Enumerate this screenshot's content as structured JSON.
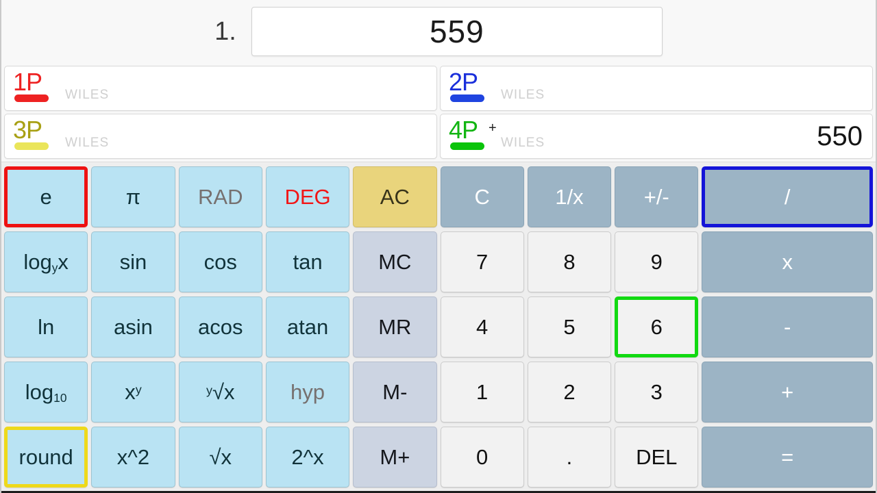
{
  "display": {
    "round_label": "1.",
    "value": "559"
  },
  "players": [
    {
      "id": "1P",
      "name": "WILES",
      "operator": "",
      "score": "",
      "color": "#ee2222",
      "bar_color": "#ee2222"
    },
    {
      "id": "2P",
      "name": "WILES",
      "operator": "",
      "score": "",
      "color": "#1a2fdb",
      "bar_color": "#1f44e0"
    },
    {
      "id": "3P",
      "name": "WILES",
      "operator": "",
      "score": "",
      "color": "#a8a014",
      "bar_color": "#eae55a"
    },
    {
      "id": "4P",
      "name": "WILES",
      "operator": "+",
      "score": "550",
      "color": "#12b512",
      "bar_color": "#0bc40b"
    }
  ],
  "keypad": {
    "rows": [
      [
        {
          "label": "e",
          "style": "k-fn",
          "highlight": "sel-red",
          "text_style": ""
        },
        {
          "label": "π",
          "style": "k-fn",
          "highlight": "",
          "text_style": ""
        },
        {
          "label": "RAD",
          "style": "k-fn",
          "highlight": "",
          "text_style": "t-gray"
        },
        {
          "label": "DEG",
          "style": "k-fn",
          "highlight": "",
          "text_style": "t-red"
        },
        {
          "label": "AC",
          "style": "k-ac",
          "highlight": "",
          "text_style": ""
        },
        {
          "label": "C",
          "style": "k-op",
          "highlight": "",
          "text_style": ""
        },
        {
          "label": "1/x",
          "style": "k-op",
          "highlight": "",
          "text_style": ""
        },
        {
          "label": "+/-",
          "style": "k-op",
          "highlight": "",
          "text_style": ""
        },
        {
          "label": "/",
          "style": "k-op",
          "highlight": "sel-blue",
          "text_style": ""
        }
      ],
      [
        {
          "label": "log_yx",
          "style": "k-fn",
          "highlight": "",
          "text_style": ""
        },
        {
          "label": "sin",
          "style": "k-fn",
          "highlight": "",
          "text_style": ""
        },
        {
          "label": "cos",
          "style": "k-fn",
          "highlight": "",
          "text_style": ""
        },
        {
          "label": "tan",
          "style": "k-fn",
          "highlight": "",
          "text_style": ""
        },
        {
          "label": "MC",
          "style": "k-mem",
          "highlight": "",
          "text_style": ""
        },
        {
          "label": "7",
          "style": "k-num",
          "highlight": "",
          "text_style": ""
        },
        {
          "label": "8",
          "style": "k-num",
          "highlight": "",
          "text_style": ""
        },
        {
          "label": "9",
          "style": "k-num",
          "highlight": "",
          "text_style": ""
        },
        {
          "label": "x",
          "style": "k-op",
          "highlight": "",
          "text_style": ""
        }
      ],
      [
        {
          "label": "ln",
          "style": "k-fn",
          "highlight": "",
          "text_style": ""
        },
        {
          "label": "asin",
          "style": "k-fn",
          "highlight": "",
          "text_style": ""
        },
        {
          "label": "acos",
          "style": "k-fn",
          "highlight": "",
          "text_style": ""
        },
        {
          "label": "atan",
          "style": "k-fn",
          "highlight": "",
          "text_style": ""
        },
        {
          "label": "MR",
          "style": "k-mem",
          "highlight": "",
          "text_style": ""
        },
        {
          "label": "4",
          "style": "k-num",
          "highlight": "",
          "text_style": ""
        },
        {
          "label": "5",
          "style": "k-num",
          "highlight": "",
          "text_style": ""
        },
        {
          "label": "6",
          "style": "k-num",
          "highlight": "sel-green",
          "text_style": ""
        },
        {
          "label": "-",
          "style": "k-op",
          "highlight": "",
          "text_style": ""
        }
      ],
      [
        {
          "label": "log_10",
          "style": "k-fn",
          "highlight": "",
          "text_style": ""
        },
        {
          "label": "x^y",
          "style": "k-fn",
          "highlight": "",
          "text_style": ""
        },
        {
          "label": "yroot",
          "style": "k-fn",
          "highlight": "",
          "text_style": ""
        },
        {
          "label": "hyp",
          "style": "k-fn",
          "highlight": "",
          "text_style": "t-gray"
        },
        {
          "label": "M-",
          "style": "k-mem",
          "highlight": "",
          "text_style": ""
        },
        {
          "label": "1",
          "style": "k-num",
          "highlight": "",
          "text_style": ""
        },
        {
          "label": "2",
          "style": "k-num",
          "highlight": "",
          "text_style": ""
        },
        {
          "label": "3",
          "style": "k-num",
          "highlight": "",
          "text_style": ""
        },
        {
          "label": "+",
          "style": "k-op",
          "highlight": "",
          "text_style": ""
        }
      ],
      [
        {
          "label": "round",
          "style": "k-fn",
          "highlight": "sel-yellow",
          "text_style": ""
        },
        {
          "label": "x^2",
          "style": "k-fn",
          "highlight": "",
          "text_style": ""
        },
        {
          "label": "√x",
          "style": "k-fn",
          "highlight": "",
          "text_style": ""
        },
        {
          "label": "2^x",
          "style": "k-fn",
          "highlight": "",
          "text_style": ""
        },
        {
          "label": "M+",
          "style": "k-mem",
          "highlight": "",
          "text_style": ""
        },
        {
          "label": "0",
          "style": "k-num",
          "highlight": "",
          "text_style": ""
        },
        {
          "label": ".",
          "style": "k-num",
          "highlight": "",
          "text_style": ""
        },
        {
          "label": "DEL",
          "style": "k-num",
          "highlight": "",
          "text_style": ""
        },
        {
          "label": "=",
          "style": "k-op",
          "highlight": "",
          "text_style": ""
        }
      ]
    ]
  }
}
